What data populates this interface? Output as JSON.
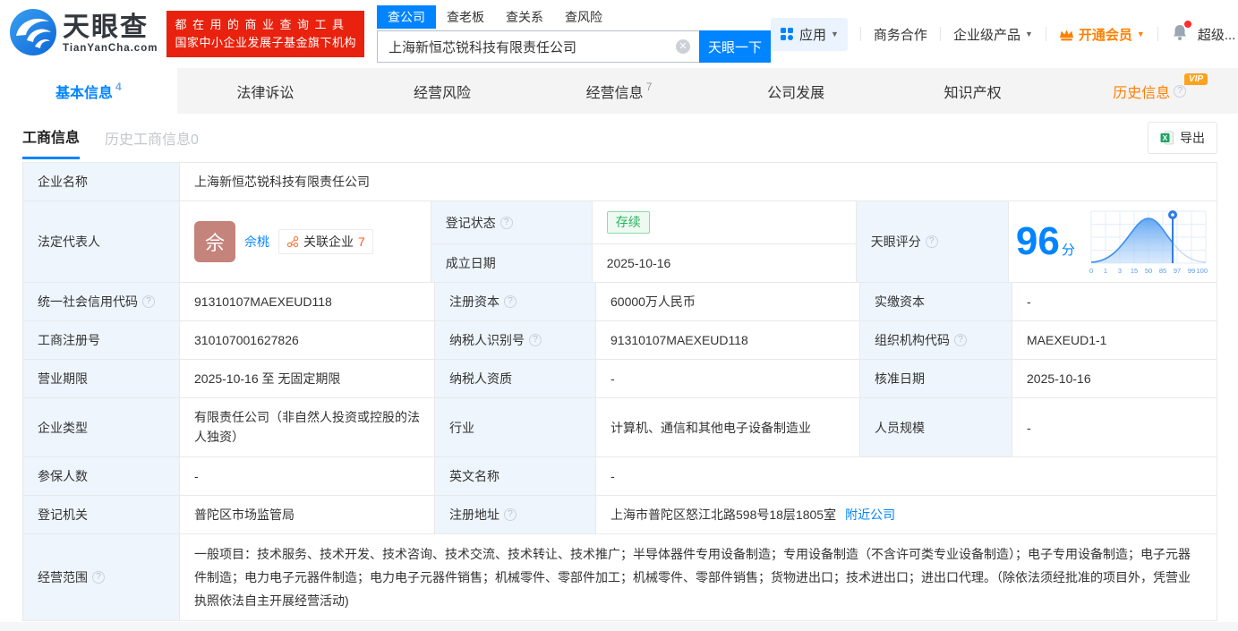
{
  "brand": {
    "name": "天眼查",
    "domain": "TianYanCha.com",
    "slogan_line1": "都在用的商业查询工具",
    "slogan_line2": "国家中小企业发展子基金旗下机构"
  },
  "search": {
    "tabs": [
      "查公司",
      "查老板",
      "查关系",
      "查风险"
    ],
    "value": "上海新恒芯锐科技有限责任公司",
    "button": "天眼一下"
  },
  "nav": {
    "apps": "应用",
    "biz": "商务合作",
    "enterprise": "企业级产品",
    "vip": "开通会员",
    "user": "超级..."
  },
  "tabs": {
    "basic": "基本信息",
    "basic_count": "4",
    "lawsuit": "法律诉讼",
    "risk": "经营风险",
    "operation": "经营信息",
    "operation_count": "7",
    "development": "公司发展",
    "ip": "知识产权",
    "history": "历史信息",
    "history_vip": "VIP"
  },
  "subtabs": {
    "current": "工商信息",
    "history": "历史工商信息0",
    "export": "导出"
  },
  "info": {
    "name_label": "企业名称",
    "name": "上海新恒芯锐科技有限责任公司",
    "legal_rep_label": "法定代表人",
    "legal_rep_initial": "佘",
    "legal_rep_name": "佘桃",
    "related_company": "关联企业",
    "related_count": "7",
    "reg_status_label": "登记状态",
    "reg_status": "存续",
    "establish_label": "成立日期",
    "establish_date": "2025-10-16",
    "score_label": "天眼评分",
    "score_value": "96",
    "score_unit": "分",
    "score_ticks": [
      "0",
      "1",
      "3",
      "15",
      "50",
      "85",
      "97",
      "99",
      "100"
    ],
    "credit_code_label": "统一社会信用代码",
    "credit_code": "91310107MAEXEUD118",
    "reg_capital_label": "注册资本",
    "reg_capital": "60000万人民币",
    "paid_capital_label": "实缴资本",
    "paid_capital": "-",
    "reg_number_label": "工商注册号",
    "reg_number": "310107001627826",
    "taxpayer_id_label": "纳税人识别号",
    "taxpayer_id": "91310107MAEXEUD118",
    "org_code_label": "组织机构代码",
    "org_code": "MAEXEUD1-1",
    "business_term_label": "营业期限",
    "business_term": "2025-10-16 至 无固定期限",
    "taxpayer_quality_label": "纳税人资质",
    "taxpayer_quality": "-",
    "approval_date_label": "核准日期",
    "approval_date": "2025-10-16",
    "company_type_label": "企业类型",
    "company_type": "有限责任公司（非自然人投资或控股的法人独资）",
    "industry_label": "行业",
    "industry": "计算机、通信和其他电子设备制造业",
    "staff_size_label": "人员规模",
    "staff_size": "-",
    "insured_label": "参保人数",
    "insured": "-",
    "english_name_label": "英文名称",
    "english_name": "-",
    "registry_label": "登记机关",
    "registry": "普陀区市场监管局",
    "address_label": "注册地址",
    "address": "上海市普陀区怒江北路598号18层1805室",
    "address_link": "附近公司",
    "scope_label": "经营范围",
    "scope": "一般项目：技术服务、技术开发、技术咨询、技术交流、技术转让、技术推广；半导体器件专用设备制造；专用设备制造（不含许可类专业设备制造）；电子专用设备制造；电子元器件制造；电力电子元器件制造；电力电子元器件销售；机械零件、零部件加工；机械零件、零部件销售；货物进出口；技术进出口；进出口代理。（除依法须经批准的项目外，凭营业执照依法自主开展经营活动)"
  }
}
